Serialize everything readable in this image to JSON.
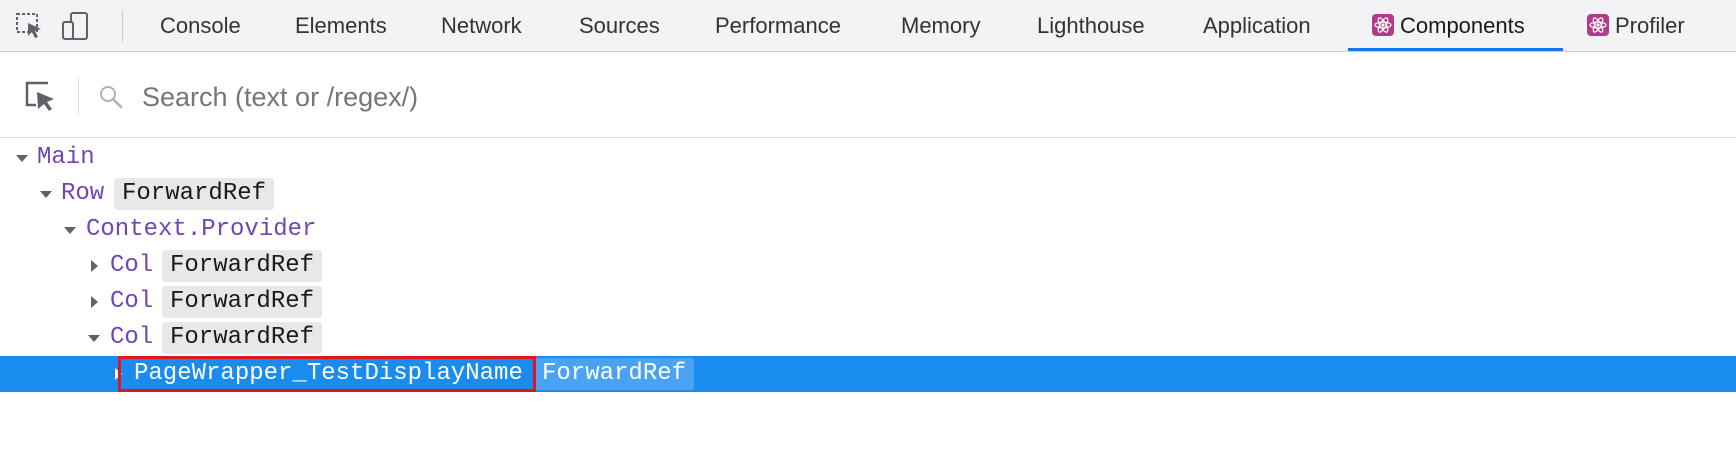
{
  "toolbar": {
    "tabs": [
      {
        "label": "Console"
      },
      {
        "label": "Elements"
      },
      {
        "label": "Network"
      },
      {
        "label": "Sources"
      },
      {
        "label": "Performance"
      },
      {
        "label": "Memory"
      },
      {
        "label": "Lighthouse"
      },
      {
        "label": "Application"
      },
      {
        "label": "Components",
        "active": true,
        "icon": "react-icon"
      },
      {
        "label": "Profiler",
        "icon": "react-icon"
      }
    ]
  },
  "search": {
    "placeholder": "Search (text or /regex/)",
    "value": ""
  },
  "tree": {
    "nodes": [
      {
        "name": "Main",
        "expanded": true
      },
      {
        "name": "Row",
        "badge": "ForwardRef",
        "expanded": true
      },
      {
        "name": "Context.Provider",
        "expanded": true
      },
      {
        "name": "Col",
        "badge": "ForwardRef",
        "expanded": false
      },
      {
        "name": "Col",
        "badge": "ForwardRef",
        "expanded": false
      },
      {
        "name": "Col",
        "badge": "ForwardRef",
        "expanded": true
      },
      {
        "name": "PageWrapper_TestDisplayName",
        "badge": "ForwardRef",
        "expanded": false,
        "selected": true
      }
    ]
  },
  "colors": {
    "accent": "#1a73e8",
    "selection": "#1a8cf0",
    "component_name": "#6e46b8",
    "highlight_border": "#e0161e"
  }
}
